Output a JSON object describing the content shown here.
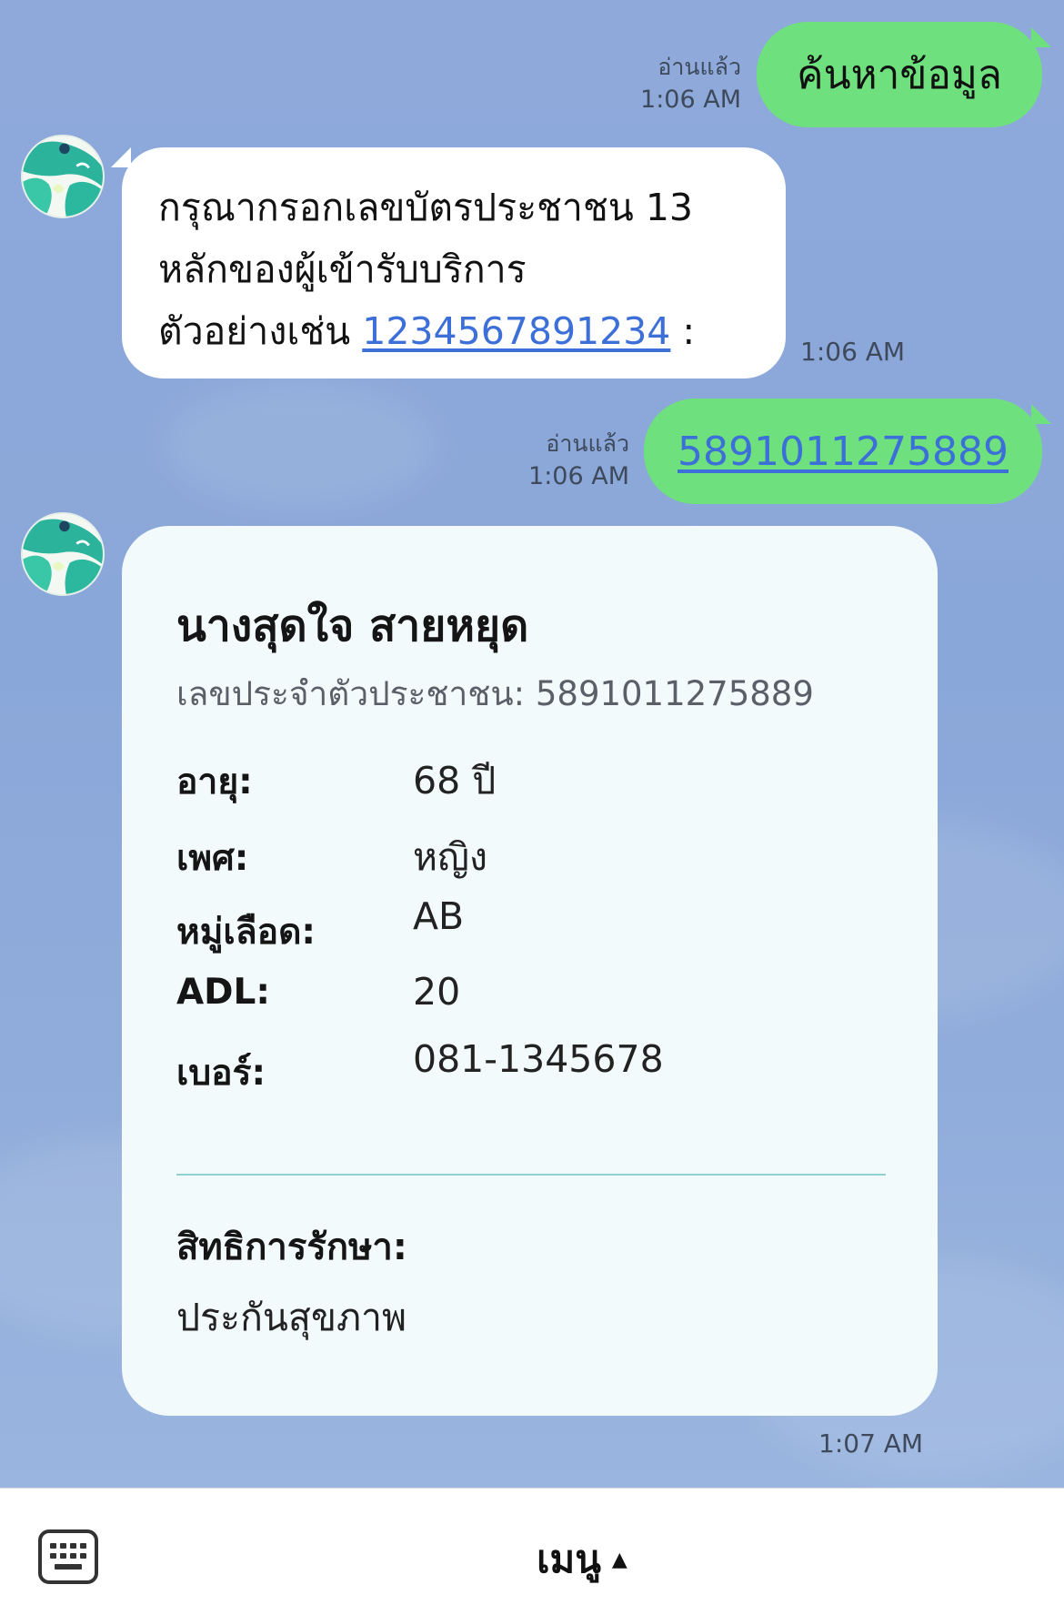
{
  "messages": {
    "m1": {
      "text": "ค้นหาข้อมูล",
      "read": "อ่านแล้ว",
      "time": "1:06 AM"
    },
    "m2": {
      "line1": "กรุณากรอกเลขบัตรประชาชน 13",
      "line2": "หลักของผู้เข้ารับบริการ",
      "line3_prefix": "ตัวอย่างเช่น",
      "example_number": "1234567891234",
      "line3_suffix": " :",
      "time": "1:06 AM"
    },
    "m3": {
      "text": "5891011275889",
      "read": "อ่านแล้ว",
      "time": "1:06 AM"
    }
  },
  "patient_card": {
    "name": "นางสุดใจ สายหยุด",
    "id_line": "เลขประจำตัวประชาชน: 5891011275889",
    "fields": [
      {
        "label": "อายุ:",
        "value": "68 ปี"
      },
      {
        "label": "เพศ:",
        "value": "หญิง"
      },
      {
        "label": "หมู่เลือด:",
        "value": "AB"
      },
      {
        "label": "ADL:",
        "value": "20"
      },
      {
        "label": "เบอร์:",
        "value": "081-1345678"
      }
    ],
    "rights_label": "สิทธิการรักษา:",
    "rights_value": "ประกันสุขภาพ",
    "time": "1:07 AM"
  },
  "bottom_bar": {
    "menu_label": "เมนู",
    "menu_caret": "▲",
    "keyboard_icon": "keyboard-icon"
  },
  "colors": {
    "chat_background": "#8ea9da",
    "outgoing_bubble": "#6fe07e",
    "incoming_bubble": "#ffffff",
    "card_background": "#f3fafc",
    "link": "#3c6fd8",
    "divider": "#8fd0d0"
  }
}
